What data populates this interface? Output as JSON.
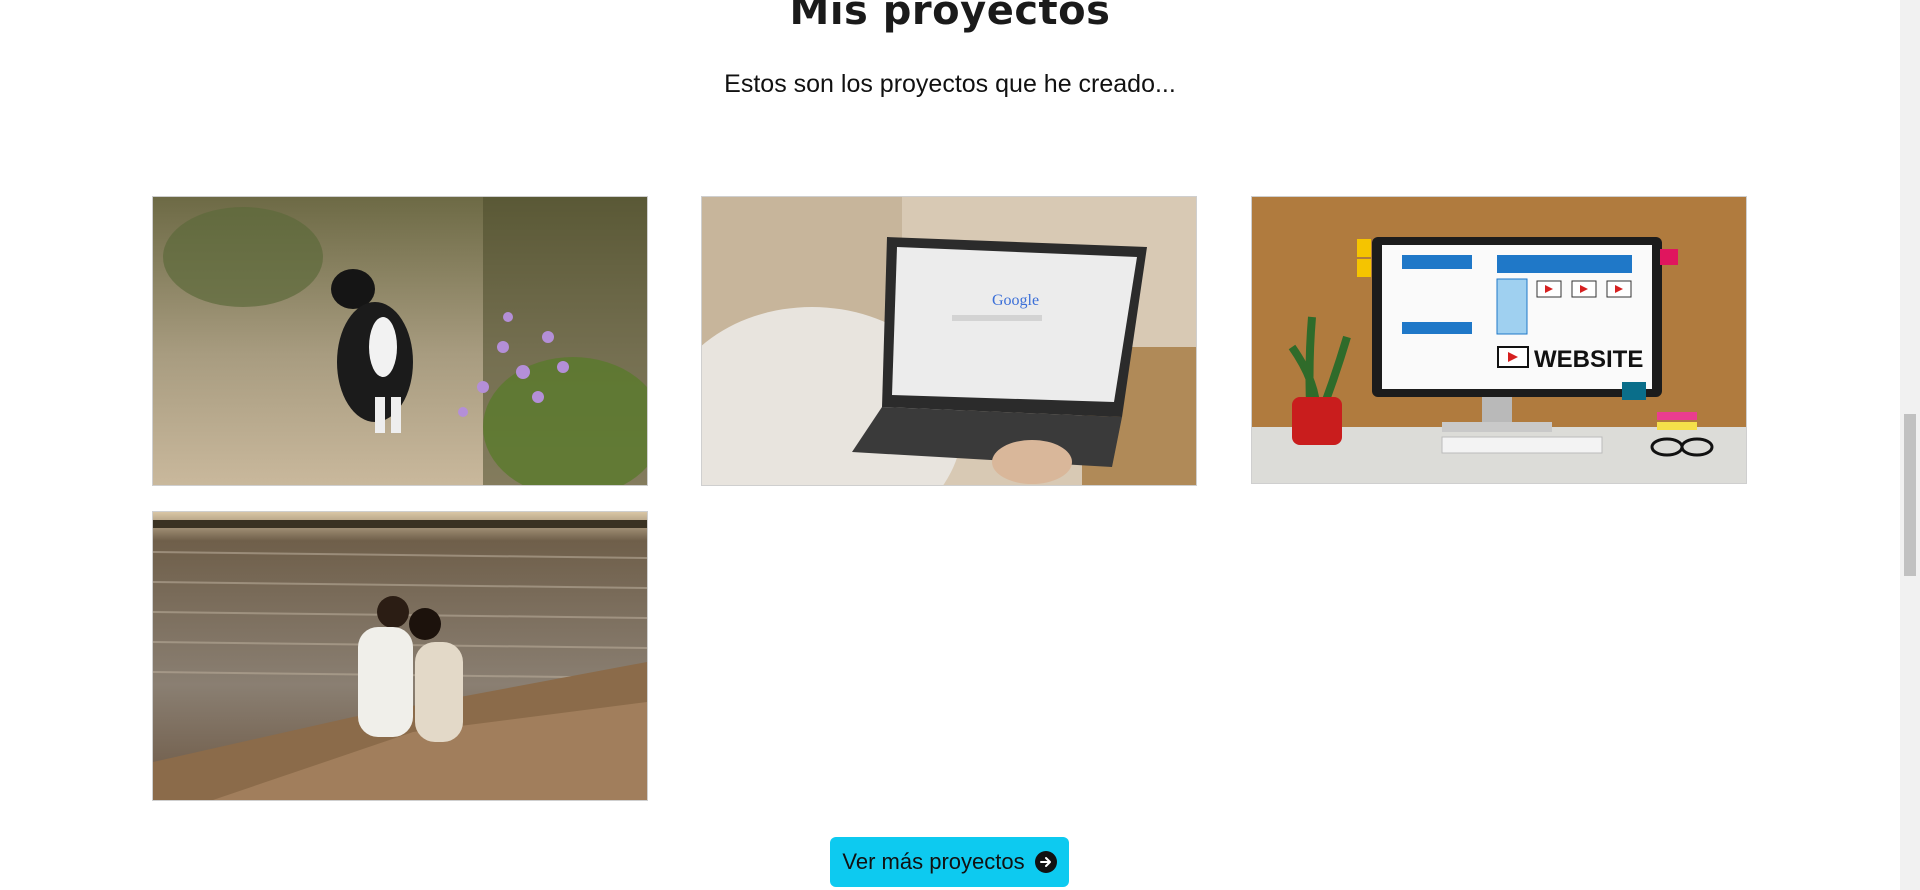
{
  "section": {
    "title": "Mis proyectos",
    "subtitle": "Estos son los proyectos que he creado..."
  },
  "projects": [
    {
      "icon": "cat-photo",
      "alt": ""
    },
    {
      "icon": "laptop-google-photo",
      "alt": ""
    },
    {
      "icon": "website-monitor-photo",
      "alt": ""
    },
    {
      "icon": "couple-lake-photo",
      "alt": ""
    }
  ],
  "screen_text": {
    "search_brand": "Google",
    "website_sign": "WEBSITE"
  },
  "button": {
    "label": "Ver más proyectos",
    "icon": "arrow-right-circle-icon",
    "color": "#0dcaf0"
  }
}
